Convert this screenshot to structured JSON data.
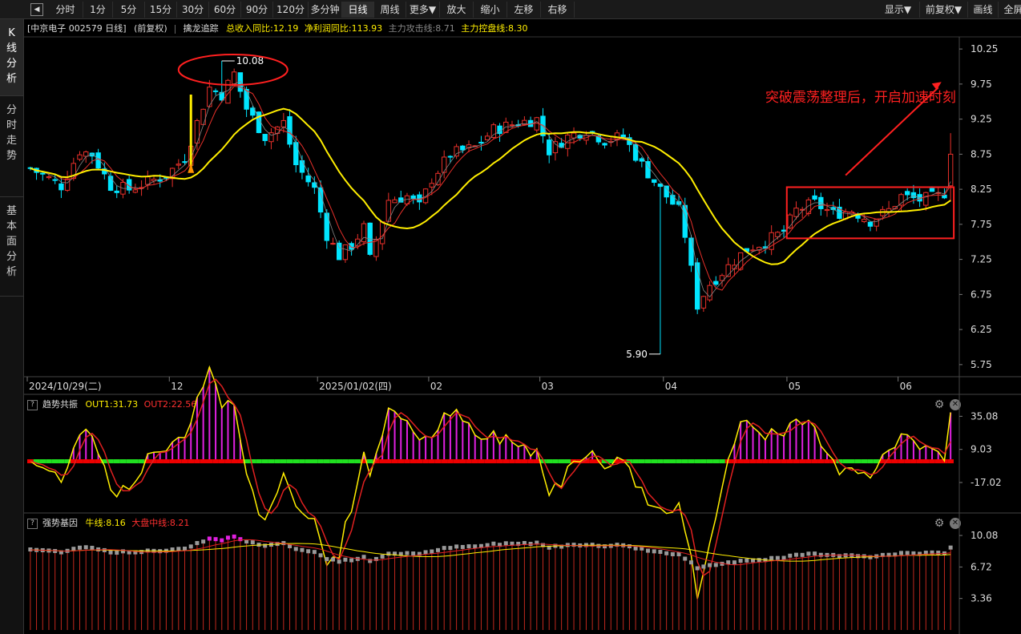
{
  "toolbar": {
    "buttons": [
      "分时",
      "1分",
      "5分",
      "15分",
      "30分",
      "60分",
      "90分",
      "120分",
      "多分钟",
      "日线",
      "周线",
      "更多▼",
      "放大",
      "缩小",
      "左移",
      "右移"
    ],
    "active": "日线",
    "right_buttons": [
      "显示▼",
      "前复权▼",
      "画线",
      "全屏"
    ]
  },
  "sidebar": {
    "tabs": [
      "K线分析",
      "分时走势",
      "基本面分析"
    ],
    "active": "K线分析"
  },
  "info": {
    "stock": "[中京电子 002579 日线]",
    "adjust": "(前复权)",
    "indicator": "擒龙追踪",
    "rev_growth": "总收入同比:12.19",
    "profit_growth": "净利润同比:113.93",
    "attack_line": "主力攻击线:8.71",
    "control_line": "主力控盘线:8.30"
  },
  "colors": {
    "up": "#e8302a",
    "down": "#00e5ff",
    "ma_fast": "#e8302a",
    "ma_slow": "#ffee00",
    "annotation": "#ff2020",
    "osc_magenta": "#e020e0",
    "green": "#20e020"
  },
  "chart_data": [
    {
      "type": "candlestick",
      "panel": "main",
      "ylim": [
        5.6,
        10.4
      ],
      "yticks": [
        "10.25",
        "9.75",
        "9.25",
        "8.75",
        "8.25",
        "7.75",
        "7.25",
        "6.75",
        "6.25",
        "5.75"
      ],
      "ytick_values": [
        10.25,
        9.75,
        9.25,
        8.75,
        8.25,
        7.75,
        7.25,
        6.75,
        6.25,
        5.75
      ],
      "x_labels": [
        {
          "label": "2024/10/29(二)",
          "index": 0
        },
        {
          "label": "12",
          "index": 23
        },
        {
          "label": "2025/01/02(四)",
          "index": 47
        },
        {
          "label": "02",
          "index": 65
        },
        {
          "label": "03",
          "index": 83
        },
        {
          "label": "04",
          "index": 103
        },
        {
          "label": "05",
          "index": 123
        },
        {
          "label": "06",
          "index": 141
        }
      ],
      "num_bars": 150,
      "keypoints": [
        [
          0,
          8.55
        ],
        [
          3,
          8.4
        ],
        [
          5,
          8.3
        ],
        [
          8,
          8.8
        ],
        [
          10,
          8.75
        ],
        [
          13,
          8.3
        ],
        [
          16,
          8.25
        ],
        [
          19,
          8.35
        ],
        [
          22,
          8.45
        ],
        [
          25,
          8.7
        ],
        [
          29,
          9.7
        ],
        [
          31,
          9.6
        ],
        [
          33,
          9.9
        ],
        [
          35,
          9.4
        ],
        [
          38,
          9.0
        ],
        [
          41,
          9.2
        ],
        [
          43,
          8.6
        ],
        [
          46,
          8.25
        ],
        [
          48,
          7.6
        ],
        [
          50,
          7.3
        ],
        [
          52,
          7.45
        ],
        [
          54,
          7.7
        ],
        [
          55,
          7.25
        ],
        [
          58,
          8.1
        ],
        [
          61,
          8.15
        ],
        [
          63,
          8.0
        ],
        [
          65,
          8.4
        ],
        [
          68,
          8.75
        ],
        [
          72,
          8.85
        ],
        [
          75,
          9.1
        ],
        [
          79,
          9.2
        ],
        [
          82,
          9.25
        ],
        [
          84,
          8.8
        ],
        [
          87,
          9.0
        ],
        [
          90,
          9.1
        ],
        [
          93,
          8.95
        ],
        [
          96,
          9.0
        ],
        [
          99,
          8.6
        ],
        [
          102,
          8.25
        ],
        [
          105,
          7.95
        ],
        [
          106,
          7.6
        ],
        [
          108,
          6.6
        ],
        [
          110,
          6.9
        ],
        [
          113,
          7.15
        ],
        [
          116,
          7.4
        ],
        [
          119,
          7.5
        ],
        [
          122,
          7.65
        ],
        [
          124,
          7.95
        ],
        [
          127,
          8.05
        ],
        [
          130,
          7.9
        ],
        [
          133,
          7.95
        ],
        [
          136,
          7.8
        ],
        [
          139,
          7.95
        ],
        [
          141,
          8.15
        ],
        [
          144,
          8.1
        ],
        [
          147,
          8.15
        ],
        [
          148,
          8.2
        ],
        [
          149,
          8.75
        ]
      ],
      "annotations": [
        {
          "text": "10.08",
          "value": 10.08,
          "index": 31
        },
        {
          "text": "5.90",
          "value": 5.9,
          "index": 102
        },
        {
          "text": "突破震荡整理后，开启加速时刻"
        }
      ]
    },
    {
      "type": "bar+line",
      "panel": "趋势共振",
      "title": "趋势共振",
      "out1_label": "OUT1:31.73",
      "out2_label": "OUT2:22.56",
      "yticks": [
        "35.08",
        "9.03",
        "-17.02"
      ],
      "ytick_values": [
        35.08,
        9.03,
        -17.02
      ],
      "ylim": [
        -41,
        41
      ]
    },
    {
      "type": "bar+line",
      "panel": "强势基因",
      "title": "强势基因",
      "bull_label": "牛线:8.16",
      "mid_label": "大盘中线:8.21",
      "yticks": [
        "10.08",
        "6.72",
        "3.36"
      ],
      "ytick_values": [
        10.08,
        6.72,
        3.36
      ],
      "ylim": [
        0,
        10.6
      ]
    }
  ]
}
